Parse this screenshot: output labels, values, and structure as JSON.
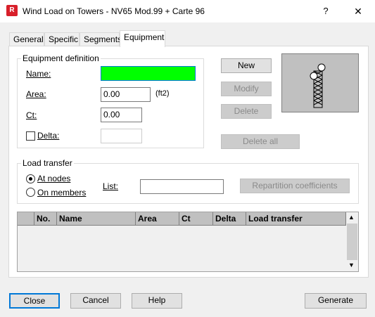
{
  "window": {
    "title": "Wind Load on Towers - NV65 Mod.99 + Carte 96",
    "app_icon_text": "R",
    "help_label": "?",
    "close_label": "✕"
  },
  "tabs": [
    {
      "label": "General"
    },
    {
      "label": "Specific"
    },
    {
      "label": "Segments"
    },
    {
      "label": "Equipment"
    }
  ],
  "equipment_definition": {
    "title": "Equipment definition",
    "name_label": "Name:",
    "name_value": "",
    "area_label": "Area:",
    "area_value": "0.00",
    "area_unit": "(ft2)",
    "ct_label": "Ct:",
    "ct_value": "0.00",
    "delta_label": "Delta:",
    "delta_value": ""
  },
  "actions": {
    "new_label": "New",
    "modify_label": "Modify",
    "delete_label": "Delete",
    "delete_all_label": "Delete all"
  },
  "load_transfer": {
    "title": "Load transfer",
    "at_nodes_label": "At nodes",
    "on_members_label": "On members",
    "list_label": "List:",
    "list_value": "",
    "repartition_label": "Repartition coefficients"
  },
  "table": {
    "columns": [
      "No.",
      "Name",
      "Area",
      "Ct",
      "Delta",
      "Load transfer"
    ],
    "rows": []
  },
  "footer": {
    "close_label": "Close",
    "cancel_label": "Cancel",
    "help_label": "Help",
    "generate_label": "Generate"
  },
  "colors": {
    "name_field_fill": "#00ff00",
    "default_button_border": "#0078d7"
  }
}
